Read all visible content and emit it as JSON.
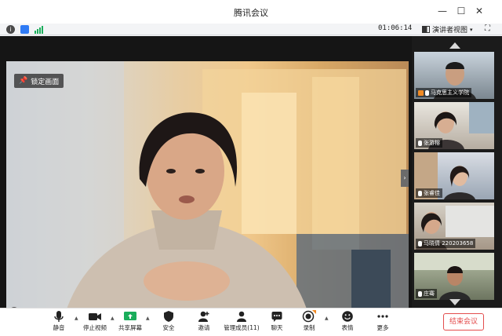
{
  "window": {
    "title": "腾讯会议"
  },
  "infobar": {
    "timer": "01:06:14",
    "layout_label": "演讲者视图"
  },
  "main_video": {
    "lock_label": "锁定画面"
  },
  "participants": [
    {
      "name": "马克思主义学院"
    },
    {
      "name": "张游榕"
    },
    {
      "name": "张睿佳"
    },
    {
      "name": "马晓倩 220203658"
    },
    {
      "name": "庄骞"
    }
  ],
  "toolbar": {
    "mute": "静音",
    "stop_video": "停止视频",
    "share_screen": "共享屏幕",
    "security": "安全",
    "invite": "邀请",
    "manage_members": "管理成员(11)",
    "chat": "聊天",
    "record": "录制",
    "reactions": "表情",
    "more": "更多",
    "end_meeting": "结束会议"
  },
  "colors": {
    "accent_green": "#1aad5b",
    "end_red": "#e34d4d",
    "accent_blue": "#2f7bf5"
  }
}
